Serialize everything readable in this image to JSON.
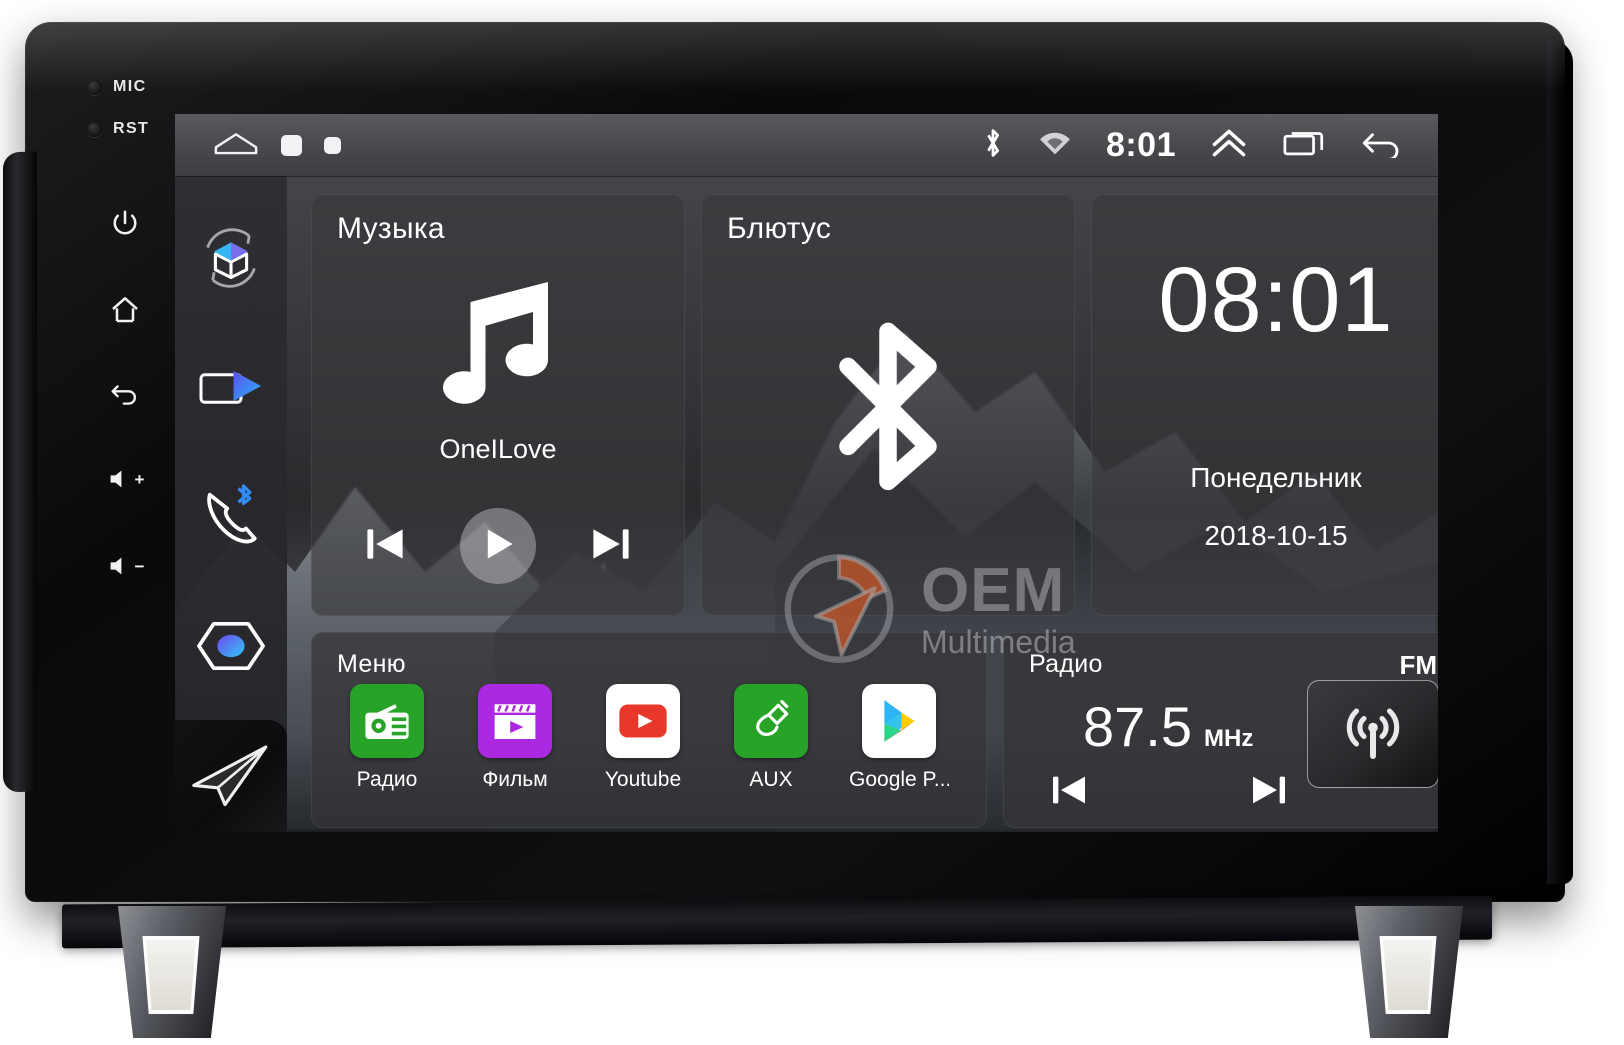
{
  "device": {
    "name": "android-car-head-unit",
    "bezel_leds": [
      {
        "id": "mic",
        "label": "MIC"
      },
      {
        "id": "rst",
        "label": "RST"
      }
    ],
    "hardware_buttons": [
      {
        "id": "power",
        "icon": "power-icon",
        "label": ""
      },
      {
        "id": "home",
        "icon": "home-icon",
        "label": ""
      },
      {
        "id": "back",
        "icon": "back-arrow-icon",
        "label": ""
      },
      {
        "id": "volume-up",
        "icon": "volume-up-icon",
        "label": "+"
      },
      {
        "id": "volume-down",
        "icon": "volume-down-icon",
        "label": "−"
      }
    ]
  },
  "statusbar": {
    "home_icon": "home-outline-icon",
    "page_indicator_1": "page-square-icon",
    "page_indicator_2": "page-square-small-icon",
    "bluetooth_icon": "bluetooth-icon",
    "wifi_icon": "wifi-icon",
    "time": "8:01",
    "expand_icon": "chevron-double-up-icon",
    "recents_icon": "recents-icon",
    "back_icon": "back-arrow-icon"
  },
  "rail": {
    "items": [
      {
        "id": "apps",
        "icon": "cube-apps-icon"
      },
      {
        "id": "media",
        "icon": "video-play-icon"
      },
      {
        "id": "phone-bt",
        "icon": "bluetooth-phone-icon"
      },
      {
        "id": "settings",
        "icon": "hexagon-settings-icon"
      },
      {
        "id": "navigation",
        "icon": "paper-plane-nav-icon"
      }
    ]
  },
  "cards": {
    "music": {
      "title": "Музыка",
      "icon": "music-note-icon",
      "track": "OneILove",
      "prev_icon": "skip-previous-icon",
      "play_icon": "play-icon",
      "next_icon": "skip-next-icon"
    },
    "bluetooth": {
      "title": "Блютус",
      "icon": "bluetooth-icon"
    },
    "clock": {
      "time": "08:01",
      "weekday": "Понедельник",
      "date": "2018-10-15"
    },
    "menu": {
      "title": "Меню",
      "apps": [
        {
          "label": "Радио",
          "icon": "radio-app-icon",
          "color": "#27a327"
        },
        {
          "label": "Фильм",
          "icon": "movie-app-icon",
          "color": "#ab29e0"
        },
        {
          "label": "Youtube",
          "icon": "youtube-app-icon",
          "color": "#ffffff"
        },
        {
          "label": "AUX",
          "icon": "aux-plug-icon",
          "color": "#27a327"
        },
        {
          "label": "Google P...",
          "icon": "google-play-icon",
          "color": "#ffffff"
        }
      ]
    },
    "radio": {
      "title": "Радио",
      "band": "FM",
      "frequency": "87.5",
      "unit": "MHz",
      "prev_icon": "skip-previous-icon",
      "next_icon": "skip-next-icon",
      "antenna_icon": "antenna-icon"
    }
  },
  "watermark": {
    "logo_icon": "oem-compass-logo-icon",
    "title": "OEM",
    "subtitle": "Multimedia",
    "accent_color": "#c1562a"
  }
}
